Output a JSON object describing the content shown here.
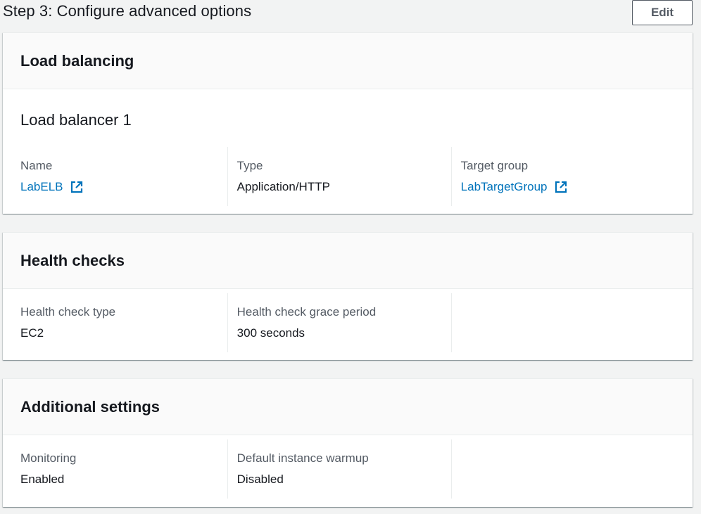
{
  "step": {
    "title": "Step 3: Configure advanced options",
    "edit_label": "Edit"
  },
  "load_balancing": {
    "title": "Load balancing",
    "subtitle": "Load balancer 1",
    "fields": {
      "name_label": "Name",
      "name_value": "LabELB",
      "type_label": "Type",
      "type_value": "Application/HTTP",
      "target_group_label": "Target group",
      "target_group_value": "LabTargetGroup"
    }
  },
  "health_checks": {
    "title": "Health checks",
    "fields": {
      "type_label": "Health check type",
      "type_value": "EC2",
      "grace_label": "Health check grace period",
      "grace_value": "300 seconds"
    }
  },
  "additional_settings": {
    "title": "Additional settings",
    "fields": {
      "monitoring_label": "Monitoring",
      "monitoring_value": "Enabled",
      "warmup_label": "Default instance warmup",
      "warmup_value": "Disabled"
    }
  },
  "icons": {
    "external_link": "external-link-icon"
  },
  "colors": {
    "link": "#0073bb",
    "label": "#545b64",
    "text": "#16191f",
    "background": "#f2f3f3"
  }
}
